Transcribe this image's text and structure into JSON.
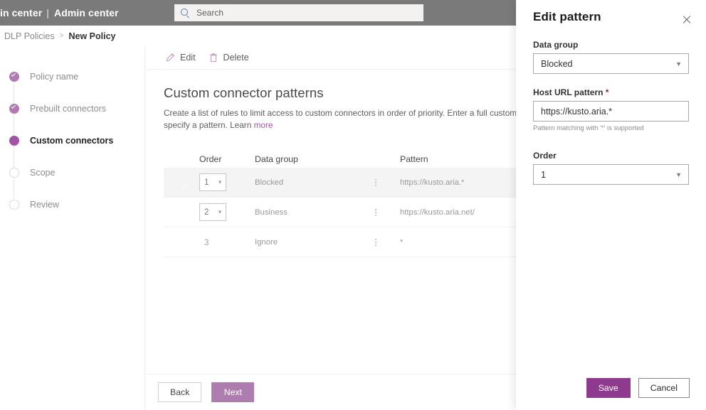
{
  "suite": {
    "brand_truncated": "in center",
    "separator": "|",
    "admin_center": "Admin center",
    "search_placeholder": "Search",
    "search_value": ""
  },
  "breadcrumb": {
    "parent": "DLP Policies",
    "separator": ">",
    "current": "New Policy"
  },
  "wizard": {
    "steps": [
      {
        "label": "Policy name",
        "state": "done"
      },
      {
        "label": "Prebuilt connectors",
        "state": "done"
      },
      {
        "label": "Custom connectors",
        "state": "active"
      },
      {
        "label": "Scope",
        "state": "todo"
      },
      {
        "label": "Review",
        "state": "todo"
      }
    ]
  },
  "command_bar": {
    "edit_label": "Edit",
    "delete_label": "Delete"
  },
  "main": {
    "title": "Custom connector patterns",
    "description": "Create a list of rules to limit access to custom connectors in order of priority. Enter a full custom connector URL or use wildcards to specify a pattern. Learn",
    "description_link": "more"
  },
  "table": {
    "columns": [
      "Order",
      "Data group",
      "Pattern"
    ],
    "rows": [
      {
        "order": "1",
        "order_control": "dropdown",
        "data_group": "Blocked",
        "pattern": "https://kusto.aria.*",
        "selected": true
      },
      {
        "order": "2",
        "order_control": "dropdown",
        "data_group": "Business",
        "pattern": "https://kusto.aria.net/",
        "selected": false
      },
      {
        "order": "3",
        "order_control": "text",
        "data_group": "Ignore",
        "pattern": "*",
        "selected": false
      }
    ]
  },
  "footer": {
    "back_label": "Back",
    "next_label": "Next"
  },
  "panel": {
    "title": "Edit pattern",
    "data_group_label": "Data group",
    "data_group_value": "Blocked",
    "host_url_label": "Host URL pattern",
    "required_marker": "*",
    "host_url_value": "https://kusto.aria.*",
    "host_url_hint": "Pattern matching with '*' is supported",
    "order_label": "Order",
    "order_value": "1",
    "save_label": "Save",
    "cancel_label": "Cancel"
  },
  "colors": {
    "accent_purple": "#a254a2",
    "save_purple": "#8e3a8e",
    "next_purple": "#ad7dad",
    "suite_bar_gray": "#7a7a7a",
    "required_red": "#a4262c"
  }
}
